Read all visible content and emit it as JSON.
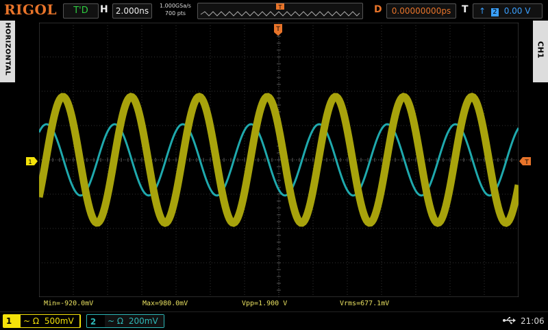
{
  "topbar": {
    "logo": "RIGOL",
    "run_mode": "T'D",
    "h_label": "H",
    "timebase": "2.000ns",
    "sample_rate": "1.000GSa/s",
    "points": "700 pts",
    "trig_marker": "T",
    "delay_label": "D",
    "delay": "0.00000000ps",
    "trig_label": "T",
    "trig_source": "2",
    "trig_level": "0.00 V",
    "accent_orange": "#e8742a",
    "run_color": "#2ecc40",
    "trig_color": "#3aa0ff"
  },
  "side": {
    "left_tab": "HORIZONTAL",
    "right_tab": "CH1"
  },
  "markers": {
    "ch1_marker": "1",
    "trig_level_marker": "T",
    "trig_pos_marker": "T"
  },
  "measurements": {
    "min": "Min=-920.0mV",
    "max": "Max=980.0mV",
    "vpp": "Vpp=1.900 V",
    "vrms": "Vrms=677.1mV"
  },
  "channels": {
    "ch1": {
      "num": "1",
      "coupling_icon": "~",
      "impedance_icon": "Ω",
      "scale": "500mV",
      "color": "#f4e20a"
    },
    "ch2": {
      "num": "2",
      "coupling_icon": "~",
      "impedance_icon": "Ω",
      "scale": "200mV",
      "color": "#2eb8b8"
    }
  },
  "status": {
    "usb_icon": "usb-icon",
    "time": "21:06"
  }
}
